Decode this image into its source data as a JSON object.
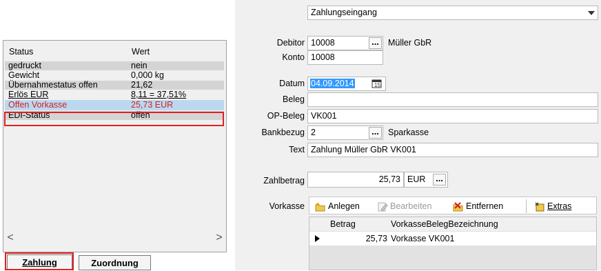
{
  "status_panel": {
    "col_status": "Status",
    "col_wert": "Wert",
    "rows": [
      {
        "status": "gedruckt",
        "wert": "nein"
      },
      {
        "status": "Gewicht",
        "wert": "0,000 kg"
      },
      {
        "status": "Übernahmestatus offen",
        "wert": "21,62"
      },
      {
        "status": "Erlös EUR",
        "wert": "8,11 = 37,51%"
      },
      {
        "status": "Offen Vorkasse",
        "wert": "25,73 EUR"
      },
      {
        "status": "EDI-Status",
        "wert": "offen"
      }
    ],
    "scroll_left": "<",
    "scroll_right": ">"
  },
  "bottom_tabs": {
    "zahlung": "Zahlung",
    "zuordnung": "Zuordnung"
  },
  "form": {
    "type_value": "Zahlungseingang",
    "debitor_label": "Debitor",
    "debitor_value": "10008",
    "debitor_name": "Müller GbR",
    "konto_label": "Konto",
    "konto_value": "10008",
    "datum_label": "Datum",
    "datum_value": "04.09.2014",
    "beleg_label": "Beleg",
    "beleg_value": "",
    "opbeleg_label": "OP-Beleg",
    "opbeleg_value": "VK001",
    "bankbezug_label": "Bankbezug",
    "bankbezug_value": "2",
    "bank_name": "Sparkasse",
    "text_label": "Text",
    "text_value": "Zahlung Müller GbR VK001",
    "zahlbetrag_label": "Zahlbetrag",
    "zahlbetrag_value": "25,73",
    "currency": "EUR",
    "ellipsis": "..."
  },
  "vorkasse": {
    "label": "Vorkasse",
    "toolbar": {
      "anlegen": "Anlegen",
      "bearbeiten": "Bearbeiten",
      "entfernen": "Entfernen",
      "extras": "Extras"
    },
    "columns": {
      "betrag": "Betrag",
      "bezeichnung": "VorkasseBelegBezeichnung"
    },
    "rows": [
      {
        "betrag": "25,73",
        "bezeichnung": "Vorkasse VK001"
      }
    ]
  }
}
